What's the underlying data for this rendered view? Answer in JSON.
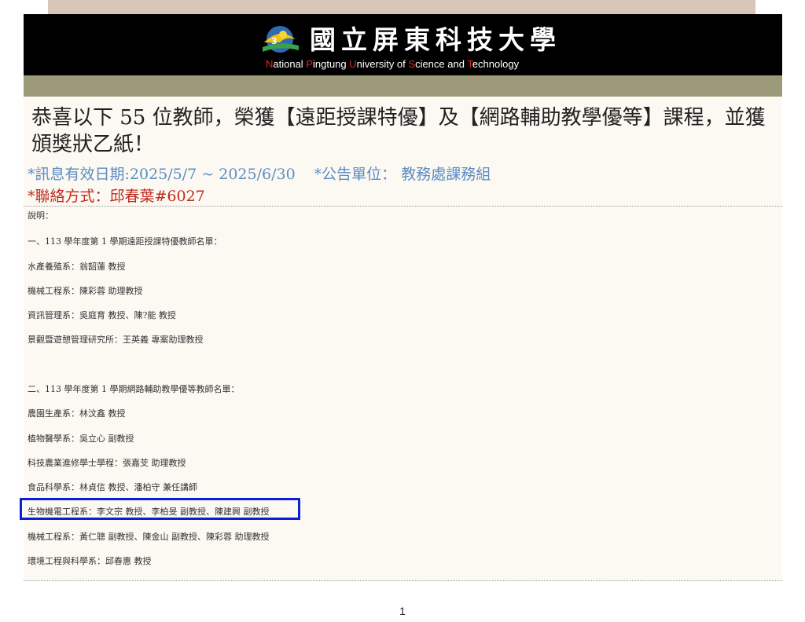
{
  "header": {
    "university_name_zh": "國立屏東科技大學",
    "university_name_en_parts": [
      {
        "cap": "N",
        "rest": "ational "
      },
      {
        "cap": "P",
        "rest": "ingtung "
      },
      {
        "cap": "U",
        "rest": "niversity of "
      },
      {
        "cap": "S",
        "rest": "cience and "
      },
      {
        "cap": "T",
        "rest": "echnology"
      }
    ],
    "logo_icon": "university-emblem-icon"
  },
  "announcement": {
    "headline": "恭喜以下 55 位教師，榮獲【遠距授課特優】及【網路輔助教學優等】課程，並獲頒獎狀乙紙！",
    "valid_dates": "*訊息有效日期:2025/5/7 ~ 2025/6/30",
    "department": "*公告單位： 教務處課務組",
    "contact": "*聯絡方式：邱春葉#6027"
  },
  "body": {
    "intro": "說明：",
    "section1_title": "一、113 學年度第 1 學期遠距授課特優教師名單：",
    "section1_items": [
      "水產養殖系：翁韶蓮 教授",
      "機械工程系：陳彩蓉 助理教授",
      "資訊管理系：吳庭育 教授、陳?能 教授",
      "景觀暨遊憩管理研究所：王英義 專案助理教授"
    ],
    "section2_title": "二、113 學年度第 1 學期網路輔助教學優等教師名單：",
    "section2_items": [
      "農園生產系：林汶鑫 教授",
      "植物醫學系：吳立心 副教授",
      "科技農業進修學士學程：張嘉芠 助理教授",
      "食品科學系：林貞信 教授、潘柏守 兼任講師",
      "生物機電工程系：李文宗 教授、李柏旻 副教授、陳建興 副教授",
      "機械工程系：黃仁聰 副教授、陳金山 副教授、陳彩蓉 助理教授",
      "環境工程與科學系：邱春惠 教授"
    ]
  },
  "footer": {
    "page_number": "1"
  },
  "colors": {
    "banner": "#000000",
    "olive_bar": "#9c9a78",
    "meta_blue": "#5b8cc4",
    "contact_red": "#c0291c",
    "highlight_border": "#0b1fd6"
  }
}
